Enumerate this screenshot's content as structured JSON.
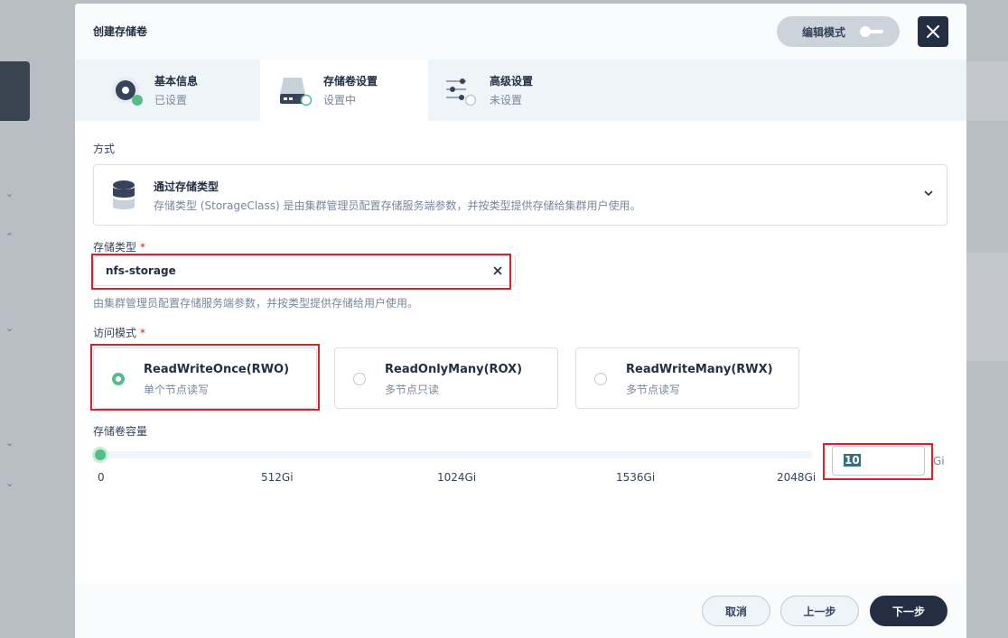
{
  "dialog": {
    "title": "创建存储卷",
    "edit_mode_label": "编辑模式"
  },
  "steps": [
    {
      "name": "基本信息",
      "state": "已设置",
      "icon": "disc-icon"
    },
    {
      "name": "存储卷设置",
      "state": "设置中",
      "icon": "drive-icon"
    },
    {
      "name": "高级设置",
      "state": "未设置",
      "icon": "sliders-icon"
    }
  ],
  "method": {
    "label": "方式",
    "title": "通过存储类型",
    "description": "存储类型 (StorageClass) 是由集群管理员配置存储服务端参数，并按类型提供存储给集群用户使用。"
  },
  "storage_class": {
    "label": "存储类型",
    "required_mark": "*",
    "value": "nfs-storage",
    "hint": "由集群管理员配置存储服务端参数，并按类型提供存储给用户使用。"
  },
  "access_mode": {
    "label": "访问模式",
    "required_mark": "*",
    "options": [
      {
        "name": "ReadWriteOnce(RWO)",
        "desc": "单个节点读写",
        "selected": true
      },
      {
        "name": "ReadOnlyMany(ROX)",
        "desc": "多节点只读",
        "selected": false
      },
      {
        "name": "ReadWriteMany(RWX)",
        "desc": "多节点读写",
        "selected": false
      }
    ]
  },
  "capacity": {
    "label": "存储卷容量",
    "ticks": [
      "0",
      "512Gi",
      "1024Gi",
      "1536Gi",
      "2048Gi"
    ],
    "value": "10",
    "max": 2048,
    "unit": "Gi"
  },
  "footer": {
    "cancel": "取消",
    "prev": "上一步",
    "next": "下一步"
  },
  "colors": {
    "accent": "#55bc8a",
    "dark": "#242e42",
    "highlight_box": "#d8222b"
  }
}
